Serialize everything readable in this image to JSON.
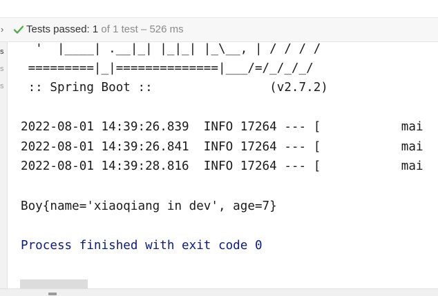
{
  "toolbar": {
    "chevron": "›",
    "status_icon": "check-icon",
    "passed_label": "Tests passed: ",
    "passed_count": "1",
    "of_total": " of 1 test",
    "duration": " – 526 ms"
  },
  "gutter": {
    "tabs": [
      "s",
      "s",
      "s"
    ]
  },
  "console": {
    "banner_lines": [
      "  '  |____| .__|_| |_|_| |_\\__, | / / / /",
      " =========|_|==============|___/=/_/_/_/",
      " :: Spring Boot ::                (v2.7.2)"
    ],
    "log_lines": [
      "2022-08-01 14:39:26.839  INFO 17264 --- [           mai",
      "2022-08-01 14:39:26.841  INFO 17264 --- [           mai",
      "2022-08-01 14:39:28.816  INFO 17264 --- [           mai"
    ],
    "output_line": "Boy{name='xiaoqiang in dev', age=7}",
    "exit_line": "Process finished with exit code 0"
  },
  "colors": {
    "text": "#1a1a1a",
    "exit_text": "#0a1a8a",
    "check": "#4caf50",
    "toolbar_bg": "#f7f7f7"
  }
}
